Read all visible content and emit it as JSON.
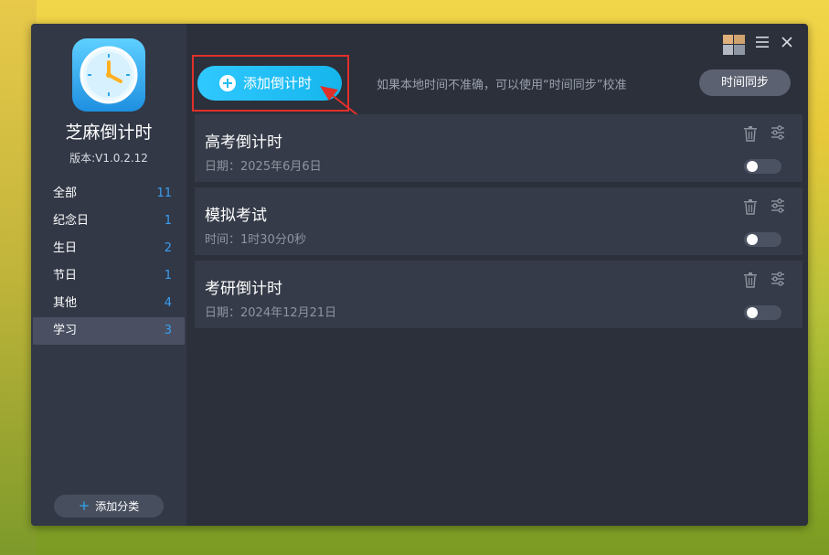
{
  "app": {
    "name": "芝麻倒计时",
    "version": "版本:V1.0.2.12"
  },
  "sidebar": {
    "categories": [
      {
        "label": "全部",
        "count": "11"
      },
      {
        "label": "纪念日",
        "count": "1"
      },
      {
        "label": "生日",
        "count": "2"
      },
      {
        "label": "节日",
        "count": "1"
      },
      {
        "label": "其他",
        "count": "4"
      },
      {
        "label": "学习",
        "count": "3"
      }
    ],
    "active_category": "学习",
    "add_category_label": "添加分类"
  },
  "toolbar": {
    "add_timer_label": "添加倒计时",
    "hint": "如果本地时间不准确，可以使用“时间同步”校准",
    "sync_label": "时间同步"
  },
  "timers": [
    {
      "title": "高考倒计时",
      "subtitle": "日期：2025年6月6日",
      "enabled": false
    },
    {
      "title": "模拟考试",
      "subtitle": "时间：1时30分0秒",
      "enabled": false
    },
    {
      "title": "考研倒计时",
      "subtitle": "日期：2024年12月21日",
      "enabled": false
    }
  ],
  "colors": {
    "accent": "#1fbcf0",
    "highlight": "#e0302a",
    "count": "#3a9ef0"
  },
  "icons": {
    "skin": "skin-icon",
    "menu": "menu-icon",
    "close": "close-icon",
    "trash": "trash-icon",
    "settings": "settings-icon"
  }
}
